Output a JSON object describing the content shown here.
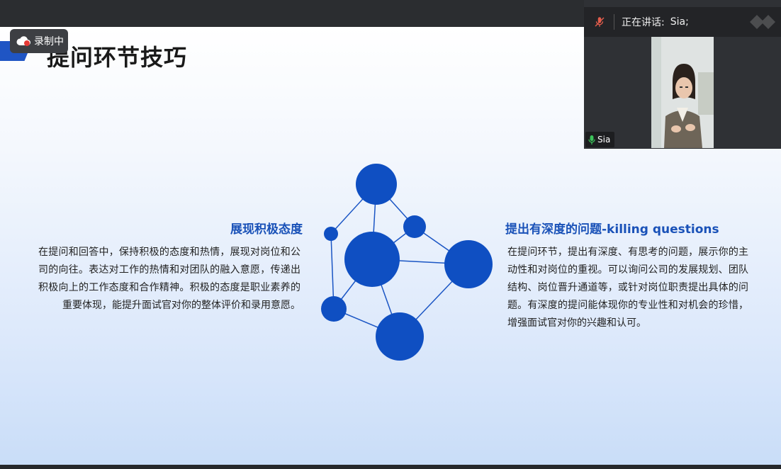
{
  "recording": {
    "label": "录制中"
  },
  "slide": {
    "title": "提问环节技巧",
    "left": {
      "heading": "展现积极态度",
      "body": "在提问和回答中，保持积极的态度和热情，展现对岗位和公司的向往。表达对工作的热情和对团队的融入意愿，传递出积极向上的工作态度和合作精神。积极的态度是职业素养的重要体现，能提升面试官对你的整体评价和录用意愿。"
    },
    "right": {
      "heading": "提出有深度的问题-killing questions",
      "body": "在提问环节，提出有深度、有思考的问题，展示你的主动性和对岗位的重视。可以询问公司的发展规划、团队结构、岗位晋升通道等，或针对岗位职责提出具体的问题。有深度的提问能体现你的专业性和对机会的珍惜，增强面试官对你的兴趣和认可。"
    },
    "colors": {
      "accent": "#1f55c4",
      "node": "#0f4fc2",
      "heading": "#1a52b8"
    }
  },
  "meeting": {
    "speaking_label": "正在讲话:",
    "speaking_name": "Sia;",
    "participant_name": "Sia",
    "icons": [
      "mic-muted-icon",
      "mic-on-icon",
      "cloud-record-icon",
      "grid-view-icon"
    ]
  }
}
